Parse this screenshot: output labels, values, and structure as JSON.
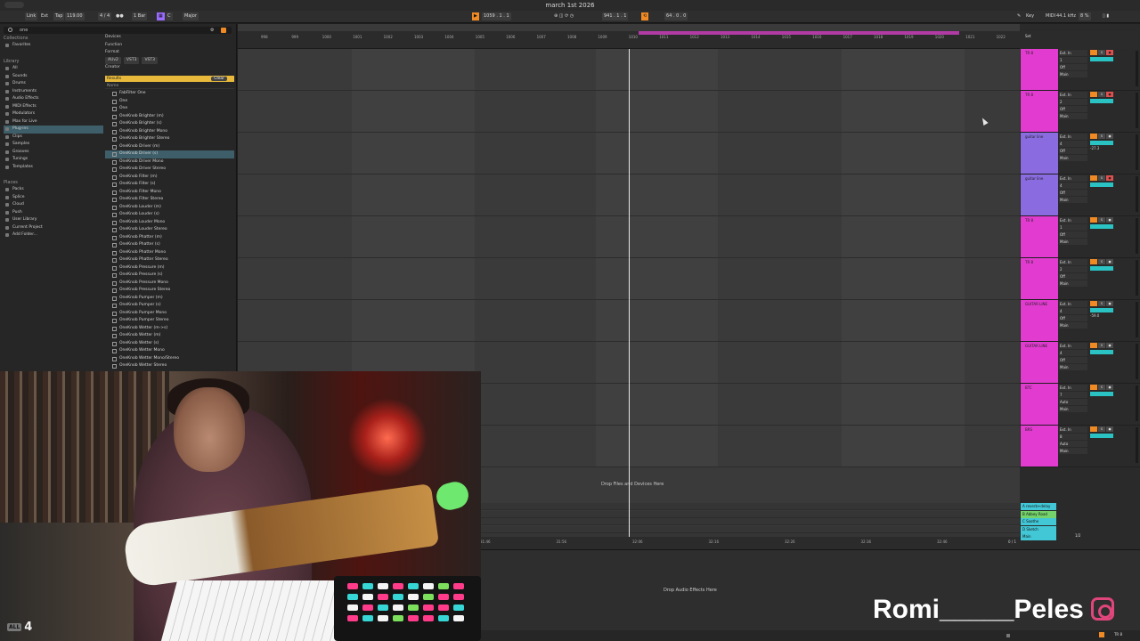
{
  "window": {
    "title": "march 1st 2026"
  },
  "transport": {
    "link": "Link",
    "ext": "Ext",
    "tap": "Tap",
    "tempo": "119.00",
    "signature": "4 / 4",
    "quantize": "1 Bar",
    "key_root": "C",
    "scale": "Major",
    "position": "1059 . 1 . 1",
    "loop_start": "941 . 1 . 1",
    "loop_length": "64 . 0 . 0",
    "key_label": "Key",
    "midi_label": "MIDI",
    "sample_rate": "44.1 kHz",
    "cpu": "8 %"
  },
  "browser": {
    "search_value": "one",
    "sidebar_sections": {
      "collections_title": "Collections",
      "collections": [
        "Favorites"
      ],
      "library_title": "Library",
      "library": [
        "All",
        "Sounds",
        "Drums",
        "Instruments",
        "Audio Effects",
        "MIDI Effects",
        "Modulators",
        "Max for Live",
        "Plug-ins",
        "Clips",
        "Samples",
        "Grooves",
        "Tunings",
        "Templates"
      ],
      "places_title": "Places",
      "places": [
        "Packs",
        "Splice",
        "Cloud",
        "Push",
        "User Library",
        "Current Project",
        "Add Folder..."
      ]
    },
    "filters": {
      "devices": "Devices",
      "function": "Function",
      "format": "Format",
      "format_chips": [
        "AUv2",
        "VST3",
        "VST3"
      ],
      "creator": "Creator"
    },
    "results_label": "Results",
    "clear_label": "Clear",
    "name_header": "Name",
    "results": [
      "FabFilter One",
      "One",
      "One",
      "OneKnob Brighter (m)",
      "OneKnob Brighter (s)",
      "OneKnob Brighter Mono",
      "OneKnob Brighter Stereo",
      "OneKnob Driver (m)",
      "OneKnob Driver (s)",
      "OneKnob Driver Mono",
      "OneKnob Driver Stereo",
      "OneKnob Filter (m)",
      "OneKnob Filter (s)",
      "OneKnob Filter Mono",
      "OneKnob Filter Stereo",
      "OneKnob Louder (m)",
      "OneKnob Louder (s)",
      "OneKnob Louder Mono",
      "OneKnob Louder Stereo",
      "OneKnob Phatter (m)",
      "OneKnob Phatter (s)",
      "OneKnob Phatter Mono",
      "OneKnob Phatter Stereo",
      "OneKnob Pressure (m)",
      "OneKnob Pressure (s)",
      "OneKnob Pressure Mono",
      "OneKnob Pressure Stereo",
      "OneKnob Pumper (m)",
      "OneKnob Pumper (s)",
      "OneKnob Pumper Mono",
      "OneKnob Pumper Stereo",
      "OneKnob Wetter (m->s)",
      "OneKnob Wetter (m)",
      "OneKnob Wetter (s)",
      "OneKnob Wetter Mono",
      "OneKnob Wetter Mono/Stereo",
      "OneKnob Wetter Stereo"
    ],
    "selected_result": "OneKnob Driver (s)"
  },
  "arrangement": {
    "bar_numbers": [
      "998",
      "999",
      "1000",
      "1001",
      "1002",
      "1003",
      "1004",
      "1005",
      "1006",
      "1007",
      "1008",
      "1009",
      "1010",
      "1011",
      "1012",
      "1013",
      "1014",
      "1015",
      "1016",
      "1017",
      "1018",
      "1019",
      "1020",
      "1021",
      "1022"
    ],
    "time_marks": [
      "31:46",
      "31:56",
      "32:06",
      "32:16",
      "32:26",
      "32:36",
      "32:46"
    ],
    "drop_files_text": "Drop Files and Devices Here",
    "set_label": "Set",
    "zoom_label": "0 / 1"
  },
  "tracks": [
    {
      "name": "TR 8",
      "color": "#e23bd0",
      "input": "Ext. In",
      "channel": "1",
      "monitor": "Off",
      "output": "Main"
    },
    {
      "name": "TR 8",
      "color": "#e23bd0",
      "input": "Ext. In",
      "channel": "2",
      "monitor": "Off",
      "output": "Main"
    },
    {
      "name": "guitar line",
      "color": "#8a6be0",
      "input": "Ext. In",
      "channel": "4",
      "monitor": "Off",
      "output": "Main",
      "vol": "-27.3"
    },
    {
      "name": "guitar line",
      "color": "#8a6be0",
      "input": "Ext. In",
      "channel": "4",
      "monitor": "Off",
      "output": "Main"
    },
    {
      "name": "TR 8",
      "color": "#e23bd0",
      "input": "Ext. In",
      "channel": "1",
      "monitor": "Off",
      "output": "Main"
    },
    {
      "name": "TR 8",
      "color": "#e23bd0",
      "input": "Ext. In",
      "channel": "2",
      "monitor": "Off",
      "output": "Main"
    },
    {
      "name": "GUITAR LINE",
      "color": "#e23bd0",
      "input": "Ext. In",
      "channel": "4",
      "monitor": "Off",
      "output": "Main",
      "vol": "-59.0"
    },
    {
      "name": "GUITAR LINE",
      "color": "#e23bd0",
      "input": "Ext. In",
      "channel": "4",
      "monitor": "Off",
      "output": "Main"
    },
    {
      "name": "BTC",
      "color": "#e23bd0",
      "input": "Ext. In",
      "channel": "7",
      "monitor": "Auto",
      "output": "Main"
    },
    {
      "name": "BRS",
      "color": "#e23bd0",
      "input": "Ext. In",
      "channel": "8",
      "monitor": "Auto",
      "output": "Main"
    }
  ],
  "returns": [
    {
      "name": "A reverb+delay",
      "color": "#42c7d6"
    },
    {
      "name": "B Abbey Road",
      "color": "#74d36a"
    },
    {
      "name": "C Soothe",
      "color": "#42c7d6"
    },
    {
      "name": "D Sketch",
      "color": "#42c7d6"
    },
    {
      "name": "Main",
      "color": "#42c7d6"
    }
  ],
  "main_out": "1/2",
  "detail": {
    "drop_text": "Drop Audio Effects Here",
    "track_label": "TR 8"
  },
  "overlay": {
    "channel_badge": "ALL",
    "channel_number": "4",
    "social_handle": "Romi_____Peles"
  }
}
